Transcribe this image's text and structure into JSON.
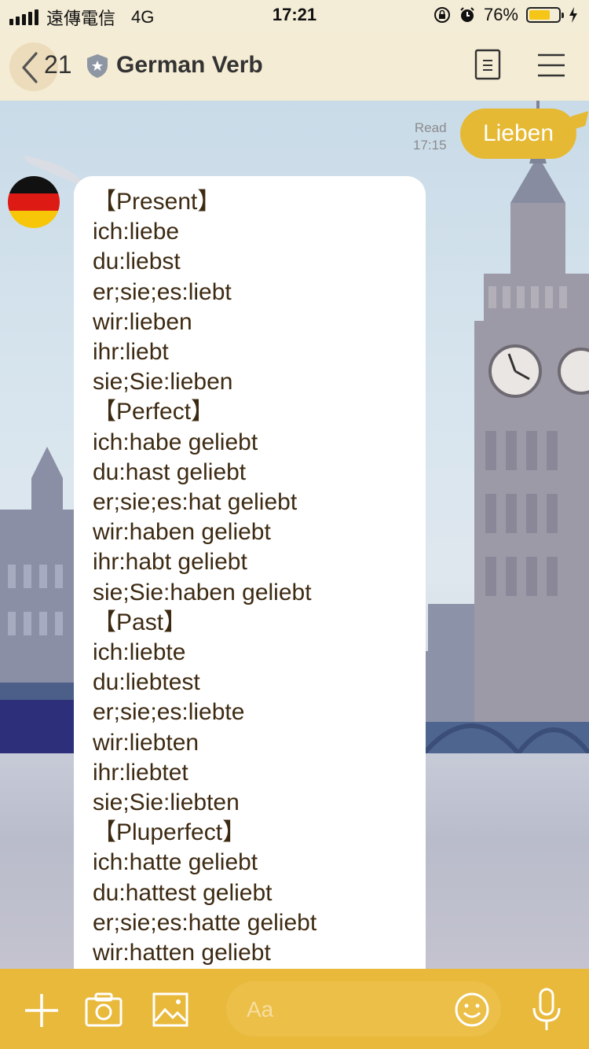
{
  "status_bar": {
    "carrier": "遠傳電信",
    "network": "4G",
    "time": "17:21",
    "battery": "76%",
    "battery_level": 0.76
  },
  "header": {
    "back_count": "21",
    "title": "German Verb"
  },
  "messages": {
    "outgoing": {
      "read_label": "Read",
      "time": "17:15",
      "text": "Lieben"
    },
    "incoming_lines": [
      "【Present】",
      "ich:liebe",
      "du:liebst",
      "er;sie;es:liebt",
      "wir:lieben",
      "ihr:liebt",
      "sie;Sie:lieben",
      "【Perfect】",
      "ich:habe geliebt",
      "du:hast geliebt",
      "er;sie;es:hat geliebt",
      "wir:haben geliebt",
      "ihr:habt geliebt",
      "sie;Sie:haben geliebt",
      "【Past】",
      "ich:liebte",
      "du:liebtest",
      "er;sie;es:liebte",
      "wir:liebten",
      "ihr:liebtet",
      "sie;Sie:liebten",
      "【Pluperfect】",
      "ich:hatte geliebt",
      "du:hattest geliebt",
      "er;sie;es:hatte geliebt",
      "wir:hatten geliebt"
    ]
  },
  "composer": {
    "placeholder": "Aa"
  },
  "colors": {
    "accent": "#e5b933",
    "bottom_bar": "#e8b93b",
    "header_bg": "#f4ecd4",
    "bubble_text": "#3d2a12"
  },
  "icons": {
    "signal": "signal-icon",
    "rotation_lock": "rotation-lock-icon",
    "alarm": "alarm-icon",
    "battery": "battery-icon",
    "charging": "charging-bolt-icon",
    "back": "chevron-left-icon",
    "official_badge": "shield-star-icon",
    "notes": "notes-icon",
    "menu": "hamburger-menu-icon",
    "add": "plus-icon",
    "camera": "camera-icon",
    "image": "image-icon",
    "emoji": "smiley-icon",
    "mic": "microphone-icon"
  }
}
